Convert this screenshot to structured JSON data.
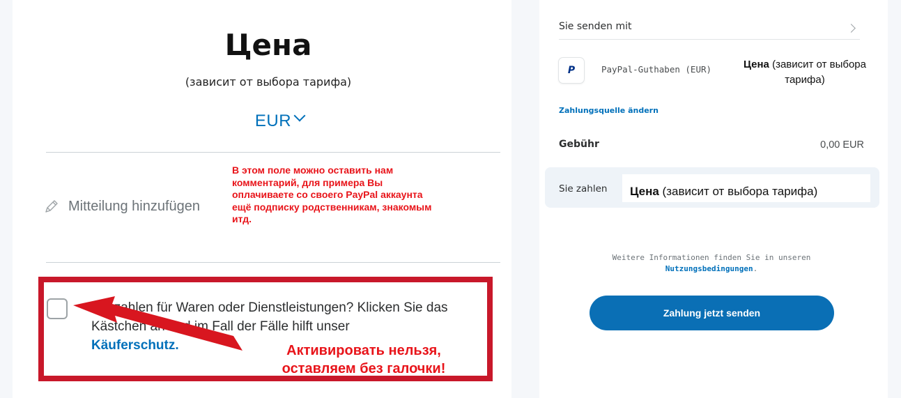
{
  "left": {
    "price_title": "Цена",
    "price_subtitle": "(зависит от выбора тарифа)",
    "currency": "EUR",
    "add_note_label": "Mitteilung hinzufügen",
    "protection_text": "Sie zahlen für Waren oder Dienstleistungen? Klicken Sie das Kästchen an und im Fall der Fälle hilft unser",
    "protection_link": "Käuferschutz."
  },
  "annotations": {
    "comment_line1": "В этом поле можно оставить нам",
    "comment_line2": "комментарий, для примера Вы",
    "comment_line3": "оплачиваете со своего PayPal аккаунта",
    "comment_line4": "ещё подписку родственникам, знакомым",
    "comment_line5": "итд.",
    "activate_line1": "Активировать нельзя,",
    "activate_line2": "оставляем без галочки!",
    "annotation_color": "#e8141a",
    "box_color": "#c8182a"
  },
  "right": {
    "send_with_label": "Sie senden mit",
    "funding_source": "PayPal-Guthaben (EUR)",
    "funding_price_bold": "Цена",
    "funding_price_rest": " (зависит от выбора тарифа)",
    "change_source_link": "Zahlungsquelle ändern",
    "fee_label": "Gebühr",
    "fee_value": "0,00 EUR",
    "pay_label": "Sie zahlen",
    "pay_price_bold": "Цена",
    "pay_price_rest": " (зависит от выбора тарифа)",
    "info_text": "Weitere Informationen finden Sie in unseren",
    "terms_link": "Nutzungsbedingungen",
    "info_period": ".",
    "send_button": "Zahlung jetzt senden"
  },
  "icons": {
    "currency_chevron": "chevron-down-icon",
    "note": "pencil-icon",
    "send_with_chevron": "chevron-right-icon",
    "paypal": "paypal-logo"
  },
  "colors": {
    "paypal_blue": "#0070ba",
    "button_blue": "#0a6fb5",
    "paypal_dark": "#003087"
  }
}
